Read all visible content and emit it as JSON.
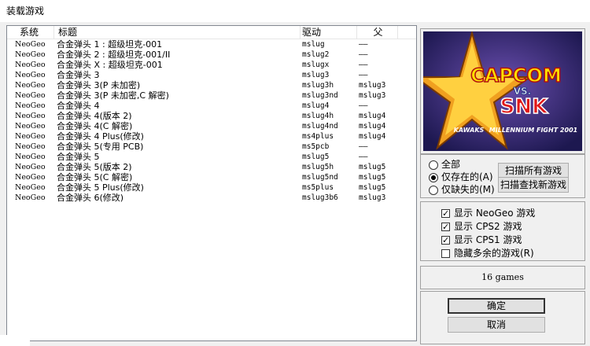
{
  "window": {
    "title": "装载游戏"
  },
  "list": {
    "headers": {
      "system": "系统",
      "title": "标题",
      "driver": "驱动",
      "parent": "父"
    },
    "rows": [
      {
        "system": "NeoGeo",
        "title": "合金弹头 1 : 超级坦克-001",
        "driver": "mslug",
        "parent": "——"
      },
      {
        "system": "NeoGeo",
        "title": "合金弹头 2 : 超级坦克-001/II",
        "driver": "mslug2",
        "parent": "——"
      },
      {
        "system": "NeoGeo",
        "title": "合金弹头 X : 超级坦克-001",
        "driver": "mslugx",
        "parent": "——"
      },
      {
        "system": "NeoGeo",
        "title": "合金弹头 3",
        "driver": "mslug3",
        "parent": "——"
      },
      {
        "system": "NeoGeo",
        "title": "合金弹头 3(P 未加密)",
        "driver": "mslug3h",
        "parent": "mslug3"
      },
      {
        "system": "NeoGeo",
        "title": "合金弹头 3(P 未加密,C 解密)",
        "driver": "mslug3nd",
        "parent": "mslug3"
      },
      {
        "system": "NeoGeo",
        "title": "合金弹头 4",
        "driver": "mslug4",
        "parent": "——"
      },
      {
        "system": "NeoGeo",
        "title": "合金弹头 4(版本 2)",
        "driver": "mslug4h",
        "parent": "mslug4"
      },
      {
        "system": "NeoGeo",
        "title": "合金弹头 4(C 解密)",
        "driver": "mslug4nd",
        "parent": "mslug4"
      },
      {
        "system": "NeoGeo",
        "title": "合金弹头 4 Plus(修改)",
        "driver": "ms4plus",
        "parent": "mslug4"
      },
      {
        "system": "NeoGeo",
        "title": "合金弹头 5(专用 PCB)",
        "driver": "ms5pcb",
        "parent": "——"
      },
      {
        "system": "NeoGeo",
        "title": "合金弹头 5",
        "driver": "mslug5",
        "parent": "——"
      },
      {
        "system": "NeoGeo",
        "title": "合金弹头 5(版本 2)",
        "driver": "mslug5h",
        "parent": "mslug5"
      },
      {
        "system": "NeoGeo",
        "title": "合金弹头 5(C 解密)",
        "driver": "mslug5nd",
        "parent": "mslug5"
      },
      {
        "system": "NeoGeo",
        "title": "合金弹头 5 Plus(修改)",
        "driver": "ms5plus",
        "parent": "mslug5"
      },
      {
        "system": "NeoGeo",
        "title": "合金弹头 6(修改)",
        "driver": "mslug3b6",
        "parent": "mslug3"
      }
    ]
  },
  "preview": {
    "logo_top": "CAPCOM",
    "logo_vs": "VS.",
    "logo_bottom": "SNK",
    "logo_sub": "MILLENNIUM FIGHT 2001",
    "logo_brand": "KAWAKS"
  },
  "filter": {
    "all_label": "全部",
    "existing_label": "仅存在的(A)",
    "missing_label": "仅缺失的(M)",
    "selected": "existing",
    "scan_all_label": "扫描所有游戏",
    "scan_new_label": "扫描查找新游戏"
  },
  "display": {
    "neogeo_label": "显示 NeoGeo 游戏",
    "cps2_label": "显示 CPS2 游戏",
    "cps1_label": "显示 CPS1 游戏",
    "hide_label": "隐藏多余的游戏(R)",
    "neogeo_checked": true,
    "cps2_checked": true,
    "cps1_checked": true,
    "hide_checked": false
  },
  "status": {
    "count_text": "16 games"
  },
  "actions": {
    "ok_label": "确定",
    "cancel_label": "取消"
  }
}
